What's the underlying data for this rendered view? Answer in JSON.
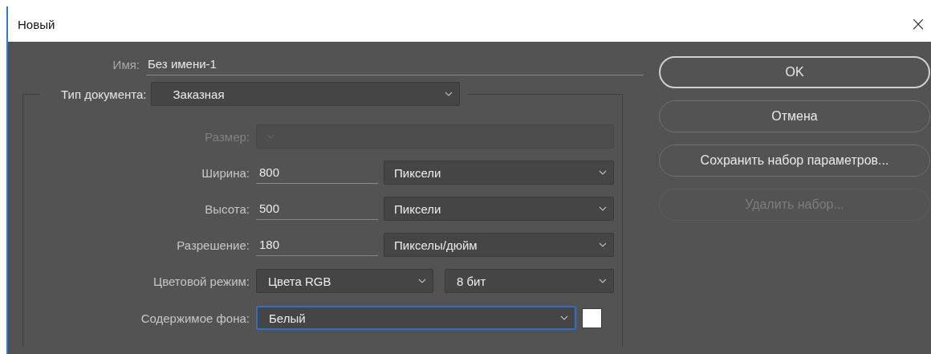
{
  "window": {
    "title": "Новый",
    "close": "×"
  },
  "name": {
    "label": "Имя:",
    "value": "Без имени-1"
  },
  "document_type": {
    "label": "Тип документа:",
    "value": "Заказная"
  },
  "rows": [
    {
      "kind": "select",
      "label": "Размер:",
      "disabled": true,
      "focused": false
    },
    {
      "kind": "input_select",
      "label": "Ширина:",
      "value": "800",
      "unit": "Пиксели",
      "disabled": false,
      "focused": false
    },
    {
      "kind": "input_select",
      "label": "Высота:",
      "value": "500",
      "unit": "Пиксели",
      "disabled": false,
      "focused": false
    },
    {
      "kind": "input_select",
      "label": "Разрешение:",
      "value": "180",
      "unit": "Пикселы/дюйм",
      "disabled": false,
      "focused": false
    },
    {
      "kind": "select_pair",
      "label": "Цветовой режим:",
      "value": "Цвета RGB",
      "unit": "8 бит",
      "disabled": false,
      "focused": false
    },
    {
      "kind": "select_swatch",
      "label": "Содержимое фона:",
      "value": "Белый",
      "disabled": false,
      "focused": true
    }
  ],
  "buttons": [
    {
      "label": "OK",
      "default": true,
      "disabled": false
    },
    {
      "label": "Отмена",
      "default": false,
      "disabled": false
    },
    {
      "label": "Сохранить набор параметров...",
      "default": false,
      "disabled": false
    },
    {
      "label": "Удалить набор...",
      "default": false,
      "disabled": true
    }
  ]
}
